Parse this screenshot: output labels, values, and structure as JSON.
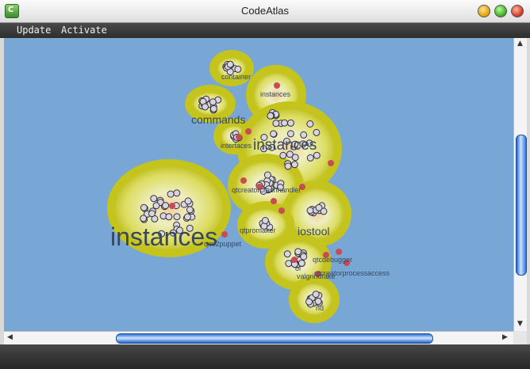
{
  "window": {
    "title": "CodeAtlas",
    "app_icon_letter": "C"
  },
  "menu": {
    "items": [
      "Update",
      "Activate"
    ]
  },
  "map": {
    "labels": [
      {
        "text": "container",
        "size": "small"
      },
      {
        "text": "instances",
        "size": "small"
      },
      {
        "text": "commands",
        "size": "medium"
      },
      {
        "text": "instances",
        "size": "large"
      },
      {
        "text": "interfaces",
        "size": "small"
      },
      {
        "text": "qtcreatorcrashhandler",
        "size": "small"
      },
      {
        "text": "instances",
        "size": "xlarge"
      },
      {
        "text": "iostool",
        "size": "medium"
      },
      {
        "text": "qtpromaker",
        "size": "small"
      },
      {
        "text": "qml2puppet",
        "size": "small"
      },
      {
        "text": "qtcdebugger",
        "size": "small"
      },
      {
        "text": "valgrindfake",
        "size": "small"
      },
      {
        "text": "qtcreatorprocessaccess",
        "size": "small"
      },
      {
        "text": "ol",
        "size": "small"
      },
      {
        "text": "nd",
        "size": "small"
      }
    ]
  },
  "colors": {
    "sea": "#78a7d6",
    "land_outer": "#c9c92a",
    "land_inner": "#eaeaa8",
    "hot": "#e6a070",
    "node": "#d6d2e2",
    "hub": "#c84c55"
  }
}
